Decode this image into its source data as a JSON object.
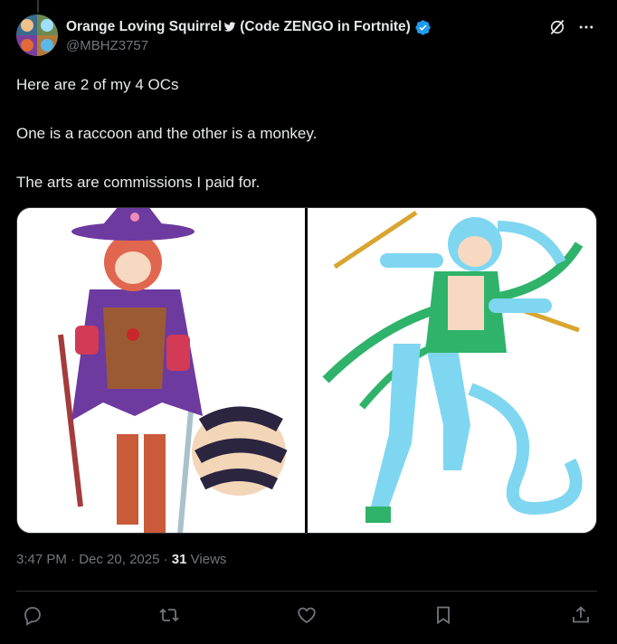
{
  "author": {
    "display_name": "Orange Loving Squirrel",
    "display_suffix": "(Code ZENGO in Fortnite)",
    "handle": "@MBHZ3757"
  },
  "tweet": {
    "lines": [
      "Here are 2 of my 4 OCs",
      "One is a raccoon and the other is a monkey.",
      "The arts are commissions I paid for."
    ]
  },
  "media": {
    "images": [
      {
        "subject": "raccoon OC illustration"
      },
      {
        "subject": "monkey OC illustration"
      }
    ]
  },
  "meta": {
    "time": "3:47 PM",
    "date": "Dec 20, 2025",
    "separator": "·",
    "views_count": "31",
    "views_label": "Views"
  },
  "icons": {
    "header": [
      "bird-icon",
      "verified-icon",
      "grok-icon",
      "more-icon"
    ],
    "actions": [
      "reply-icon",
      "retweet-icon",
      "like-icon",
      "bookmark-icon",
      "share-icon"
    ]
  },
  "colors": {
    "background": "#000000",
    "text": "#e7e9ea",
    "secondary": "#71767b",
    "verified": "#1d9bf0",
    "divider": "#2f3336"
  }
}
